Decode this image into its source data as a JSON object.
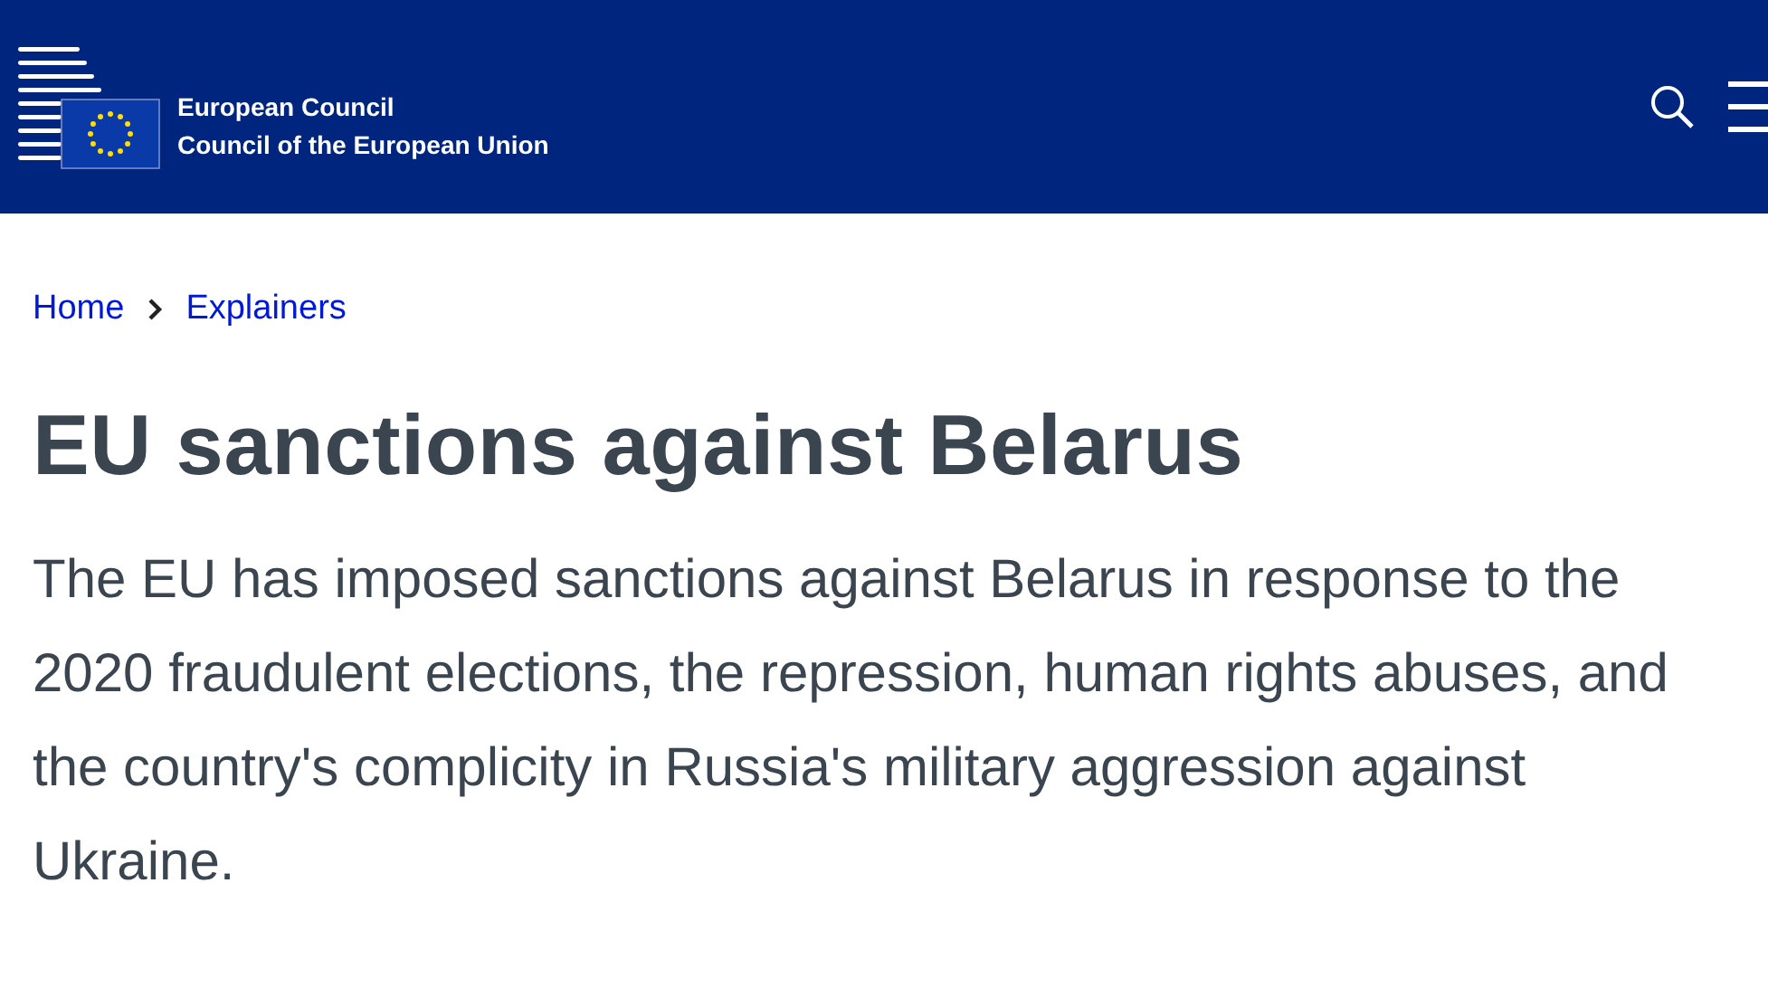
{
  "header": {
    "brand": [
      "European Council",
      "Council of the European Union"
    ]
  },
  "breadcrumb": [
    {
      "label": "Home"
    },
    {
      "label": "Explainers"
    }
  ],
  "title": "EU sanctions against Belarus",
  "intro": "The EU has imposed sanctions against Belarus in response to the 2020 fraudulent elections, the repression, human rights abuses, and the country's complicity in Russia's military aggression against Ukraine."
}
